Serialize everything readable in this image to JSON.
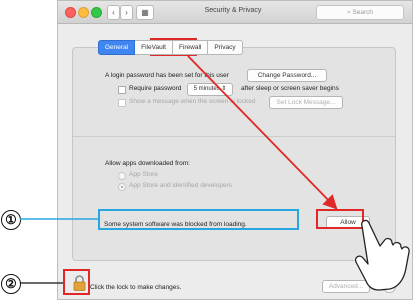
{
  "window": {
    "title": "Security & Privacy",
    "search_placeholder": "Search",
    "nav": {
      "back": "‹",
      "forward": "›",
      "grid": "▦"
    }
  },
  "tabs": [
    {
      "label": "General",
      "selected": true
    },
    {
      "label": "FileVault",
      "selected": false
    },
    {
      "label": "Firewall",
      "selected": false
    },
    {
      "label": "Privacy",
      "selected": false
    }
  ],
  "general": {
    "password_text": "A login password has been set for this user",
    "change_password_button": "Change Password...",
    "require_password_label": "Require password",
    "require_password_value": "5 minutes",
    "after_sleep_text": "after sleep or screen saver begins",
    "show_message_label": "Show a message when the screen is locked",
    "set_lock_message_button": "Set Lock Message...",
    "allow_apps_heading": "Allow apps downloaded from:",
    "option_app_store": "App Store",
    "option_app_store_identified": "App Store and identified developers",
    "blocked_message": "Some system software was blocked from loading.",
    "allow_button": "Allow"
  },
  "footer": {
    "lock_text": "Click the lock to make changes.",
    "advanced_button": "Advanced...",
    "help_button": "?"
  },
  "annotations": {
    "callout_1": "①",
    "callout_2": "②"
  },
  "colors": {
    "highlight_red": "#e02828",
    "highlight_blue": "#27a7de",
    "selected_tab": "#3f86f3"
  }
}
